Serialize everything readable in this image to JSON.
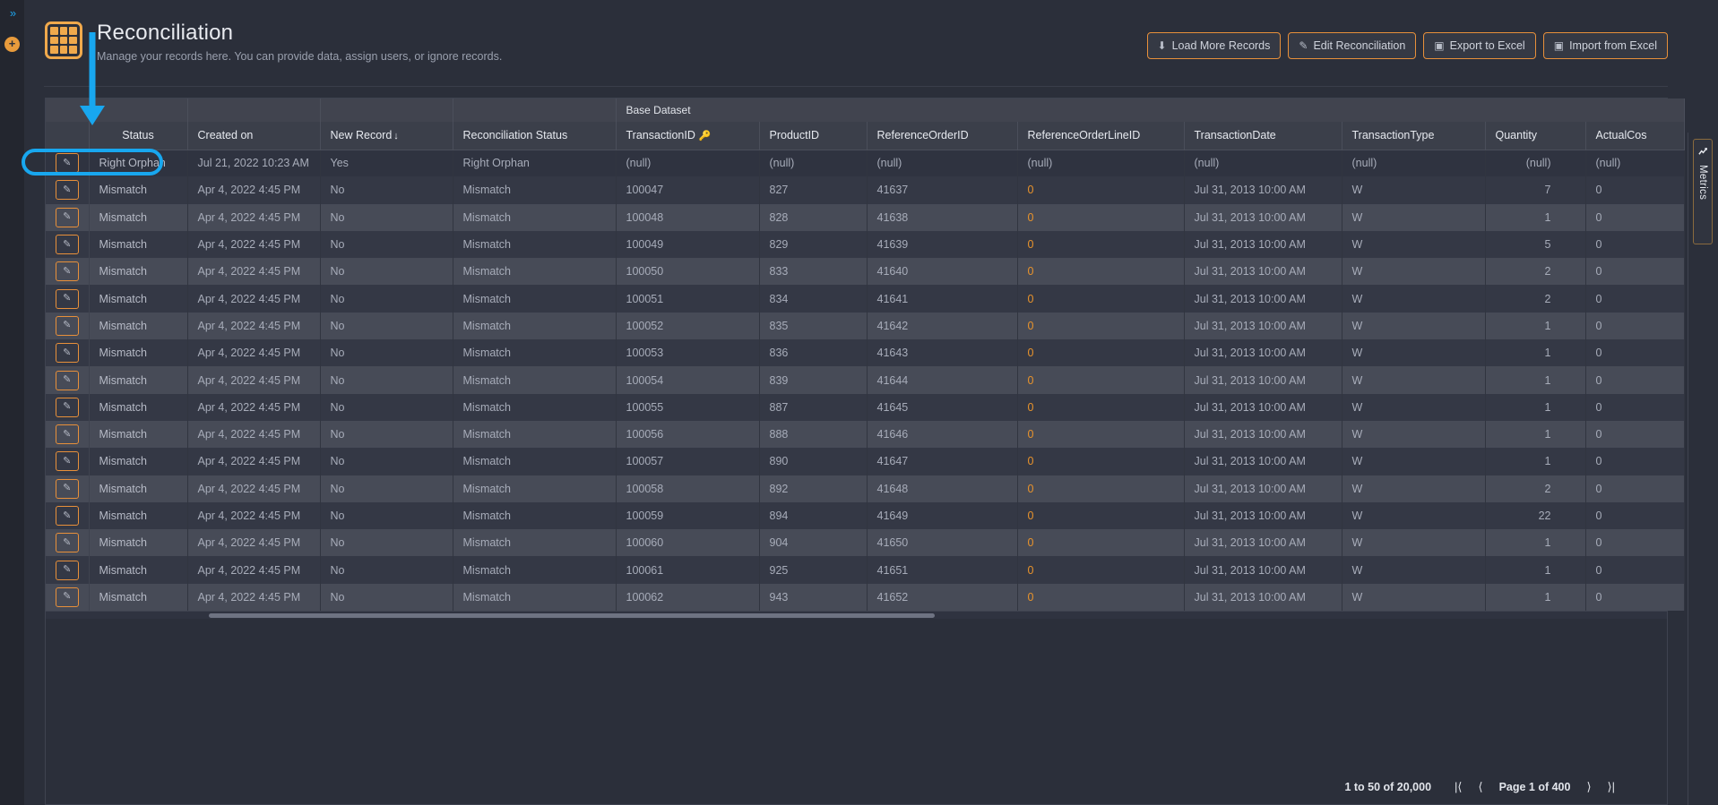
{
  "rail": {
    "expand_icon": "chevrons-right-icon",
    "expand_glyph": "»",
    "add_glyph": "✛",
    "add_icon": "circle-plus-icon"
  },
  "header": {
    "icon": "grid-table-icon",
    "title": "Reconciliation",
    "subtitle": "Manage your records here. You can provide data, assign users, or ignore records.",
    "actions": [
      {
        "label": "Load More Records",
        "icon": "download-circle-icon",
        "glyph": "⬇"
      },
      {
        "label": "Edit Reconciliation",
        "icon": "pencil-square-icon",
        "glyph": "✎"
      },
      {
        "label": "Export to Excel",
        "icon": "excel-file-icon",
        "glyph": "▣"
      },
      {
        "label": "Import from Excel",
        "icon": "excel-file-icon",
        "glyph": "▣"
      }
    ]
  },
  "metrics_tab": {
    "label": "Metrics",
    "icon": "line-chart-icon",
    "glyph": "📈"
  },
  "grid": {
    "group_header": {
      "label": "Base Dataset"
    },
    "columns": [
      {
        "key": "edit",
        "label": "",
        "align": "center"
      },
      {
        "key": "status",
        "label": "Status",
        "align": "center"
      },
      {
        "key": "created_on",
        "label": "Created on",
        "align": "left"
      },
      {
        "key": "new_record",
        "label": "New Record",
        "align": "left",
        "sort": "desc",
        "sort_glyph": "↓"
      },
      {
        "key": "reconciliation_status",
        "label": "Reconciliation Status",
        "align": "left"
      },
      {
        "key": "transaction_id",
        "label": "TransactionID",
        "align": "left",
        "key_icon": "key-icon",
        "key_glyph": "🔑"
      },
      {
        "key": "product_id",
        "label": "ProductID",
        "align": "left"
      },
      {
        "key": "reference_order_id",
        "label": "ReferenceOrderID",
        "align": "left"
      },
      {
        "key": "reference_order_line_id",
        "label": "ReferenceOrderLineID",
        "align": "left"
      },
      {
        "key": "transaction_date",
        "label": "TransactionDate",
        "align": "left"
      },
      {
        "key": "transaction_type",
        "label": "TransactionType",
        "align": "left"
      },
      {
        "key": "quantity",
        "label": "Quantity",
        "align": "right"
      },
      {
        "key": "actual_cost",
        "label": "ActualCos",
        "align": "left"
      }
    ],
    "rows": [
      {
        "status": "Right Orphan",
        "created_on": "Jul 21, 2022 10:23 AM",
        "new_record": "Yes",
        "reconciliation_status": "Right Orphan",
        "transaction_id": "(null)",
        "product_id": "(null)",
        "reference_order_id": "(null)",
        "reference_order_line_id": "(null)",
        "transaction_date": "(null)",
        "transaction_type": "(null)",
        "quantity": "(null)",
        "actual_cost": "(null)"
      },
      {
        "status": "Mismatch",
        "created_on": "Apr 4, 2022 4:45 PM",
        "new_record": "No",
        "reconciliation_status": "Mismatch",
        "transaction_id": "100047",
        "product_id": "827",
        "reference_order_id": "41637",
        "reference_order_line_id": "0",
        "transaction_date": "Jul 31, 2013 10:00 AM",
        "transaction_type": "W",
        "quantity": "7",
        "actual_cost": "0"
      },
      {
        "status": "Mismatch",
        "created_on": "Apr 4, 2022 4:45 PM",
        "new_record": "No",
        "reconciliation_status": "Mismatch",
        "transaction_id": "100048",
        "product_id": "828",
        "reference_order_id": "41638",
        "reference_order_line_id": "0",
        "transaction_date": "Jul 31, 2013 10:00 AM",
        "transaction_type": "W",
        "quantity": "1",
        "actual_cost": "0"
      },
      {
        "status": "Mismatch",
        "created_on": "Apr 4, 2022 4:45 PM",
        "new_record": "No",
        "reconciliation_status": "Mismatch",
        "transaction_id": "100049",
        "product_id": "829",
        "reference_order_id": "41639",
        "reference_order_line_id": "0",
        "transaction_date": "Jul 31, 2013 10:00 AM",
        "transaction_type": "W",
        "quantity": "5",
        "actual_cost": "0"
      },
      {
        "status": "Mismatch",
        "created_on": "Apr 4, 2022 4:45 PM",
        "new_record": "No",
        "reconciliation_status": "Mismatch",
        "transaction_id": "100050",
        "product_id": "833",
        "reference_order_id": "41640",
        "reference_order_line_id": "0",
        "transaction_date": "Jul 31, 2013 10:00 AM",
        "transaction_type": "W",
        "quantity": "2",
        "actual_cost": "0"
      },
      {
        "status": "Mismatch",
        "created_on": "Apr 4, 2022 4:45 PM",
        "new_record": "No",
        "reconciliation_status": "Mismatch",
        "transaction_id": "100051",
        "product_id": "834",
        "reference_order_id": "41641",
        "reference_order_line_id": "0",
        "transaction_date": "Jul 31, 2013 10:00 AM",
        "transaction_type": "W",
        "quantity": "2",
        "actual_cost": "0"
      },
      {
        "status": "Mismatch",
        "created_on": "Apr 4, 2022 4:45 PM",
        "new_record": "No",
        "reconciliation_status": "Mismatch",
        "transaction_id": "100052",
        "product_id": "835",
        "reference_order_id": "41642",
        "reference_order_line_id": "0",
        "transaction_date": "Jul 31, 2013 10:00 AM",
        "transaction_type": "W",
        "quantity": "1",
        "actual_cost": "0"
      },
      {
        "status": "Mismatch",
        "created_on": "Apr 4, 2022 4:45 PM",
        "new_record": "No",
        "reconciliation_status": "Mismatch",
        "transaction_id": "100053",
        "product_id": "836",
        "reference_order_id": "41643",
        "reference_order_line_id": "0",
        "transaction_date": "Jul 31, 2013 10:00 AM",
        "transaction_type": "W",
        "quantity": "1",
        "actual_cost": "0"
      },
      {
        "status": "Mismatch",
        "created_on": "Apr 4, 2022 4:45 PM",
        "new_record": "No",
        "reconciliation_status": "Mismatch",
        "transaction_id": "100054",
        "product_id": "839",
        "reference_order_id": "41644",
        "reference_order_line_id": "0",
        "transaction_date": "Jul 31, 2013 10:00 AM",
        "transaction_type": "W",
        "quantity": "1",
        "actual_cost": "0"
      },
      {
        "status": "Mismatch",
        "created_on": "Apr 4, 2022 4:45 PM",
        "new_record": "No",
        "reconciliation_status": "Mismatch",
        "transaction_id": "100055",
        "product_id": "887",
        "reference_order_id": "41645",
        "reference_order_line_id": "0",
        "transaction_date": "Jul 31, 2013 10:00 AM",
        "transaction_type": "W",
        "quantity": "1",
        "actual_cost": "0"
      },
      {
        "status": "Mismatch",
        "created_on": "Apr 4, 2022 4:45 PM",
        "new_record": "No",
        "reconciliation_status": "Mismatch",
        "transaction_id": "100056",
        "product_id": "888",
        "reference_order_id": "41646",
        "reference_order_line_id": "0",
        "transaction_date": "Jul 31, 2013 10:00 AM",
        "transaction_type": "W",
        "quantity": "1",
        "actual_cost": "0"
      },
      {
        "status": "Mismatch",
        "created_on": "Apr 4, 2022 4:45 PM",
        "new_record": "No",
        "reconciliation_status": "Mismatch",
        "transaction_id": "100057",
        "product_id": "890",
        "reference_order_id": "41647",
        "reference_order_line_id": "0",
        "transaction_date": "Jul 31, 2013 10:00 AM",
        "transaction_type": "W",
        "quantity": "1",
        "actual_cost": "0"
      },
      {
        "status": "Mismatch",
        "created_on": "Apr 4, 2022 4:45 PM",
        "new_record": "No",
        "reconciliation_status": "Mismatch",
        "transaction_id": "100058",
        "product_id": "892",
        "reference_order_id": "41648",
        "reference_order_line_id": "0",
        "transaction_date": "Jul 31, 2013 10:00 AM",
        "transaction_type": "W",
        "quantity": "2",
        "actual_cost": "0"
      },
      {
        "status": "Mismatch",
        "created_on": "Apr 4, 2022 4:45 PM",
        "new_record": "No",
        "reconciliation_status": "Mismatch",
        "transaction_id": "100059",
        "product_id": "894",
        "reference_order_id": "41649",
        "reference_order_line_id": "0",
        "transaction_date": "Jul 31, 2013 10:00 AM",
        "transaction_type": "W",
        "quantity": "22",
        "actual_cost": "0"
      },
      {
        "status": "Mismatch",
        "created_on": "Apr 4, 2022 4:45 PM",
        "new_record": "No",
        "reconciliation_status": "Mismatch",
        "transaction_id": "100060",
        "product_id": "904",
        "reference_order_id": "41650",
        "reference_order_line_id": "0",
        "transaction_date": "Jul 31, 2013 10:00 AM",
        "transaction_type": "W",
        "quantity": "1",
        "actual_cost": "0"
      },
      {
        "status": "Mismatch",
        "created_on": "Apr 4, 2022 4:45 PM",
        "new_record": "No",
        "reconciliation_status": "Mismatch",
        "transaction_id": "100061",
        "product_id": "925",
        "reference_order_id": "41651",
        "reference_order_line_id": "0",
        "transaction_date": "Jul 31, 2013 10:00 AM",
        "transaction_type": "W",
        "quantity": "1",
        "actual_cost": "0"
      },
      {
        "status": "Mismatch",
        "created_on": "Apr 4, 2022 4:45 PM",
        "new_record": "No",
        "reconciliation_status": "Mismatch",
        "transaction_id": "100062",
        "product_id": "943",
        "reference_order_id": "41652",
        "reference_order_line_id": "0",
        "transaction_date": "Jul 31, 2013 10:00 AM",
        "transaction_type": "W",
        "quantity": "1",
        "actual_cost": "0"
      }
    ],
    "row_edit_icon": "pencil-icon",
    "row_edit_glyph": "✎"
  },
  "footer": {
    "range_text": "1 to 50 of 20,000",
    "first_glyph": "|⟨",
    "prev_glyph": "⟨",
    "page_text": "Page 1 of 400",
    "next_glyph": "⟩",
    "last_glyph": "⟩|"
  },
  "annotation": {
    "arrow_color": "#18a7ef",
    "highlight_color": "#18a7ef",
    "target": "Status"
  }
}
